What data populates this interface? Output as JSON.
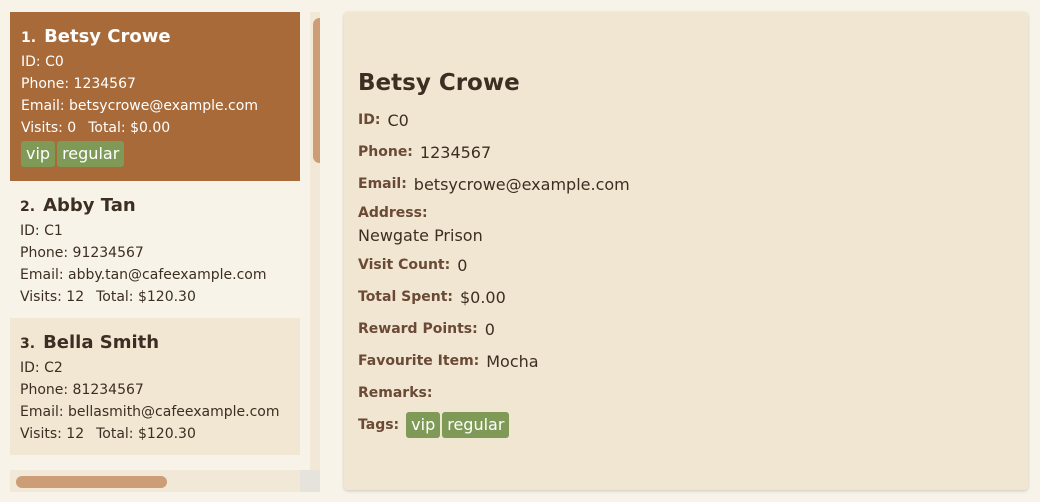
{
  "customers": [
    {
      "index": "1.",
      "name": "Betsy Crowe",
      "id": "ID: C0",
      "phone": "Phone: 1234567",
      "email": "Email: betsycrowe@example.com",
      "visits": "Visits: 0",
      "total": "Total: $0.00",
      "tags": [
        "vip",
        "regular"
      ]
    },
    {
      "index": "2.",
      "name": "Abby Tan",
      "id": "ID: C1",
      "phone": "Phone: 91234567",
      "email": "Email: abby.tan@cafeexample.com",
      "visits": "Visits: 12",
      "total": "Total: $120.30"
    },
    {
      "index": "3.",
      "name": "Bella Smith",
      "id": "ID: C2",
      "phone": "Phone: 81234567",
      "email": "Email: bellasmith@cafeexample.com",
      "visits": "Visits: 12",
      "total": "Total: $120.30"
    }
  ],
  "detail": {
    "name": "Betsy Crowe",
    "id_label": "ID:",
    "id": "C0",
    "phone_label": "Phone:",
    "phone": "1234567",
    "email_label": "Email:",
    "email": "betsycrowe@example.com",
    "address_label": "Address:",
    "address": "Newgate Prison",
    "visit_label": "Visit Count:",
    "visit": "0",
    "spent_label": "Total Spent:",
    "spent": "$0.00",
    "points_label": "Reward Points:",
    "points": "0",
    "fav_label": "Favourite Item:",
    "fav": "Mocha",
    "remarks_label": "Remarks:",
    "remarks": "",
    "tags_label": "Tags:",
    "tags": [
      "vip",
      "regular"
    ]
  },
  "colors": {
    "selected": "#a86a39",
    "tag": "#7f9a57",
    "scrollbar": "#cc9d76"
  }
}
